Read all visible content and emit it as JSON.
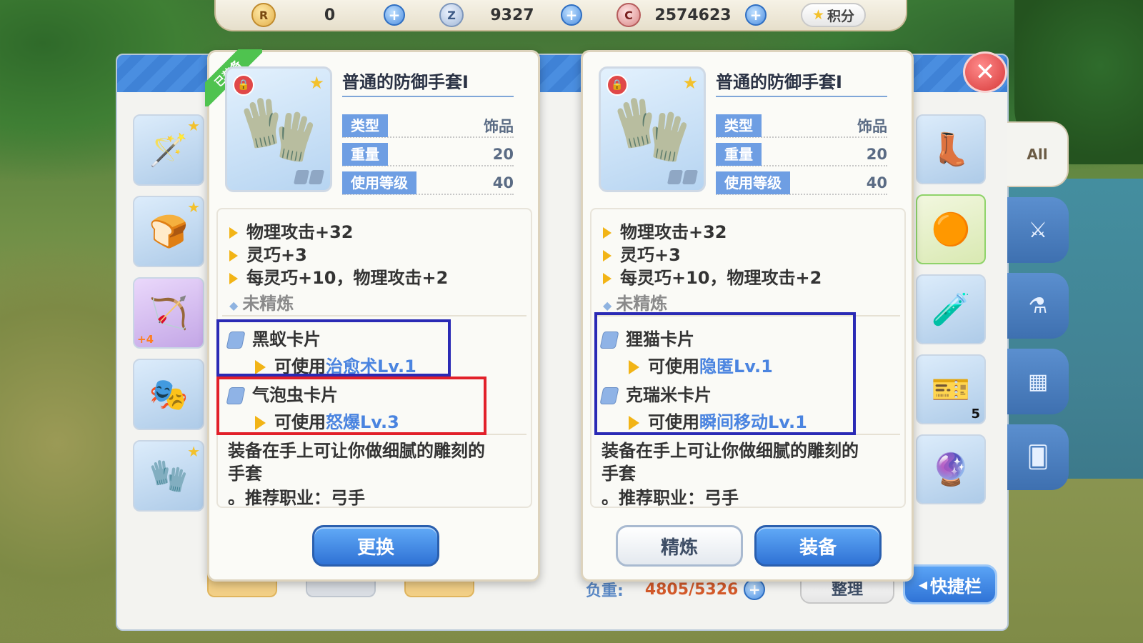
{
  "currency": {
    "r_amount": "0",
    "z_amount": "9327",
    "c_amount": "2574623",
    "points_label": "积分",
    "icons": [
      "r-coin-icon",
      "zeny-coin-icon",
      "c-coin-icon",
      "star-icon"
    ]
  },
  "bag": {
    "weight_label": "负重:",
    "weight_value": "4805/5326",
    "sort_button": "整理",
    "shortcut_button": "快捷栏",
    "filter_all_label": "All",
    "left_slot_badge": "+4",
    "right_slot_count": "5"
  },
  "left_card": {
    "equipped_label": "已装备",
    "title": "普通的防御手套Ⅰ",
    "type_label": "类型",
    "type_value": "饰品",
    "weight_label": "重量",
    "weight_value": "20",
    "level_label": "使用等级",
    "level_value": "40",
    "effects": [
      "物理攻击+32",
      "灵巧+3",
      "每灵巧+10，物理攻击+2"
    ],
    "refine_status": "未精炼",
    "cards": [
      {
        "name": "黑蚁卡片",
        "use_prefix": "可使用",
        "skill": "治愈术Lv.1"
      },
      {
        "name": "气泡虫卡片",
        "use_prefix": "可使用",
        "skill": "怒爆Lv.3"
      }
    ],
    "description_line1": "装备在手上可让你做细腻的雕刻的",
    "description_line2": "手套",
    "recommend": "。推荐职业：弓手",
    "replace_button": "更换"
  },
  "right_card": {
    "title": "普通的防御手套Ⅰ",
    "type_label": "类型",
    "type_value": "饰品",
    "weight_label": "重量",
    "weight_value": "20",
    "level_label": "使用等级",
    "level_value": "40",
    "effects": [
      "物理攻击+32",
      "灵巧+3",
      "每灵巧+10，物理攻击+2"
    ],
    "refine_status": "未精炼",
    "cards": [
      {
        "name": "狸猫卡片",
        "use_prefix": "可使用",
        "skill": "隐匿Lv.1"
      },
      {
        "name": "克瑞米卡片",
        "use_prefix": "可使用",
        "skill": "瞬间移动Lv.1"
      }
    ],
    "description_line1": "装备在手上可让你做细腻的雕刻的",
    "description_line2": "手套",
    "recommend": "。推荐职业：弓手",
    "refine_button": "精炼",
    "equip_button": "装备"
  },
  "colors": {
    "accent_blue": "#2f72d5",
    "highlight_blue": "#2a2ab5",
    "highlight_red": "#e2202a",
    "skill_text": "#4a84e0",
    "equipped_green": "#4fc34f"
  }
}
